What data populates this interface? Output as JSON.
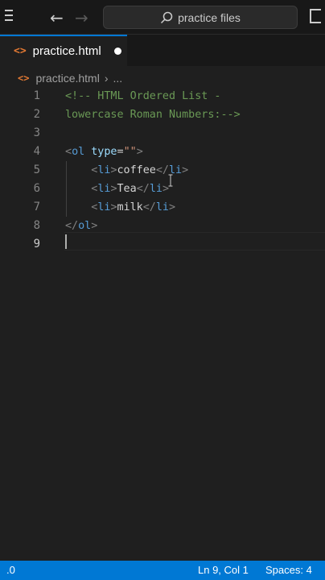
{
  "titlebar": {
    "search_label": "practice files"
  },
  "tab": {
    "label": "practice.html",
    "icon": "html-file-icon"
  },
  "breadcrumb": {
    "file": "practice.html",
    "separator": "›",
    "more": "..."
  },
  "editor": {
    "lines": [
      {
        "number": "1",
        "tokens": [
          {
            "t": "<!-- HTML Ordered List -",
            "c": "comment"
          }
        ]
      },
      {
        "number": "2",
        "tokens": [
          {
            "t": "lowercase Roman Numbers:-->",
            "c": "comment"
          }
        ]
      },
      {
        "number": "3",
        "tokens": []
      },
      {
        "number": "4",
        "tokens": [
          {
            "t": "<",
            "c": "tagp"
          },
          {
            "t": "ol",
            "c": "tagn"
          },
          {
            "t": " type",
            "c": "attr"
          },
          {
            "t": "=",
            "c": "txt"
          },
          {
            "t": "\"\"",
            "c": "str"
          },
          {
            "t": ">",
            "c": "tagp"
          }
        ]
      },
      {
        "number": "5",
        "tokens": [
          {
            "t": "    ",
            "c": "txt"
          },
          {
            "t": "<",
            "c": "tagp"
          },
          {
            "t": "li",
            "c": "tagn"
          },
          {
            "t": ">",
            "c": "tagp"
          },
          {
            "t": "coffee",
            "c": "txt"
          },
          {
            "t": "</",
            "c": "tagp"
          },
          {
            "t": "li",
            "c": "tagn"
          },
          {
            "t": ">",
            "c": "tagp"
          }
        ]
      },
      {
        "number": "6",
        "tokens": [
          {
            "t": "    ",
            "c": "txt"
          },
          {
            "t": "<",
            "c": "tagp"
          },
          {
            "t": "li",
            "c": "tagn"
          },
          {
            "t": ">",
            "c": "tagp"
          },
          {
            "t": "Tea",
            "c": "txt"
          },
          {
            "t": "</",
            "c": "tagp"
          },
          {
            "t": "li",
            "c": "tagn"
          },
          {
            "t": ">",
            "c": "tagp"
          }
        ]
      },
      {
        "number": "7",
        "tokens": [
          {
            "t": "    ",
            "c": "txt"
          },
          {
            "t": "<",
            "c": "tagp"
          },
          {
            "t": "li",
            "c": "tagn"
          },
          {
            "t": ">",
            "c": "tagp"
          },
          {
            "t": "milk",
            "c": "txt"
          },
          {
            "t": "</",
            "c": "tagp"
          },
          {
            "t": "li",
            "c": "tagn"
          },
          {
            "t": ">",
            "c": "tagp"
          }
        ]
      },
      {
        "number": "8",
        "tokens": [
          {
            "t": "</",
            "c": "tagp"
          },
          {
            "t": "ol",
            "c": "tagn"
          },
          {
            "t": ">",
            "c": "tagp"
          }
        ]
      },
      {
        "number": "9",
        "tokens": []
      }
    ],
    "active_line": "9"
  },
  "statusbar": {
    "left": ".0",
    "position": "Ln 9, Col 1",
    "spaces": "Spaces: 4"
  },
  "colors": {
    "accent": "#0078d4",
    "background": "#1f1f1f",
    "html_icon": "#e37933"
  }
}
